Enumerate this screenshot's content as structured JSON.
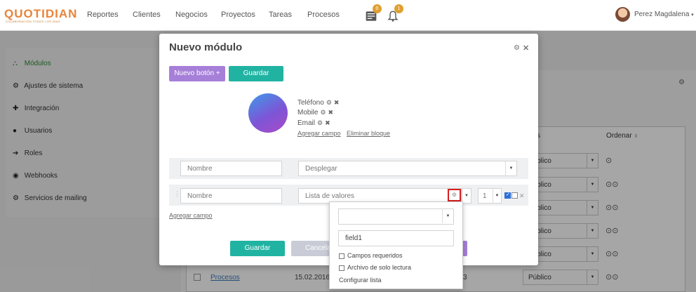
{
  "app": {
    "logo_text": "QUOTIDIAN",
    "logo_sub": "COLABORACIÓN TODOS LOS DÍAS"
  },
  "nav": {
    "items": [
      "Reportes",
      "Clientes",
      "Negocios",
      "Proyectos",
      "Tareas",
      "Procesos"
    ],
    "messages_badge": "0",
    "notifications_badge": "1",
    "user_name": "Perez Magdalena"
  },
  "sidebar": {
    "items": [
      {
        "label": "Módulos",
        "icon": "sitemap-icon"
      },
      {
        "label": "Ajustes de sistema",
        "icon": "cogs-icon"
      },
      {
        "label": "Integración",
        "icon": "puzzle-icon"
      },
      {
        "label": "Usuarios",
        "icon": "user-icon"
      },
      {
        "label": "Roles",
        "icon": "arrow-right-icon"
      },
      {
        "label": "Webhooks",
        "icon": "globe-icon"
      },
      {
        "label": "Servicios de mailing",
        "icon": "gear-icon"
      }
    ]
  },
  "background": {
    "column_partial": "s",
    "column_ordenar": "Ordenar",
    "visibility_value": "Público",
    "row_link": "Procesos",
    "row_date": "15.02.2016 0",
    "row_date_tail": "3"
  },
  "modal": {
    "title": "Nuevo módulo",
    "new_button_label": "Nuevo botón +",
    "save_top_label": "Guardar",
    "fields": [
      {
        "label": "Teléfono"
      },
      {
        "label": "Mobile"
      },
      {
        "label": "Email"
      }
    ],
    "add_field_link": "Agregar campo",
    "delete_block_link": "Eliminar bloque",
    "row1": {
      "name_placeholder": "Nombre",
      "type_value": "Desplegar"
    },
    "row2": {
      "name_placeholder": "Nombre",
      "type_value": "Lista de valores",
      "number_value": "1"
    },
    "add_field_bottom": "Agregar campo",
    "save_bottom_label": "Guardar",
    "cancel_label": "Cancela"
  },
  "popup": {
    "select_value": "",
    "field_name_value": "field1",
    "required_label": "Campos requeridos",
    "readonly_label": "Archivo de solo lectura",
    "configure_list_label": "Configurar lista"
  }
}
